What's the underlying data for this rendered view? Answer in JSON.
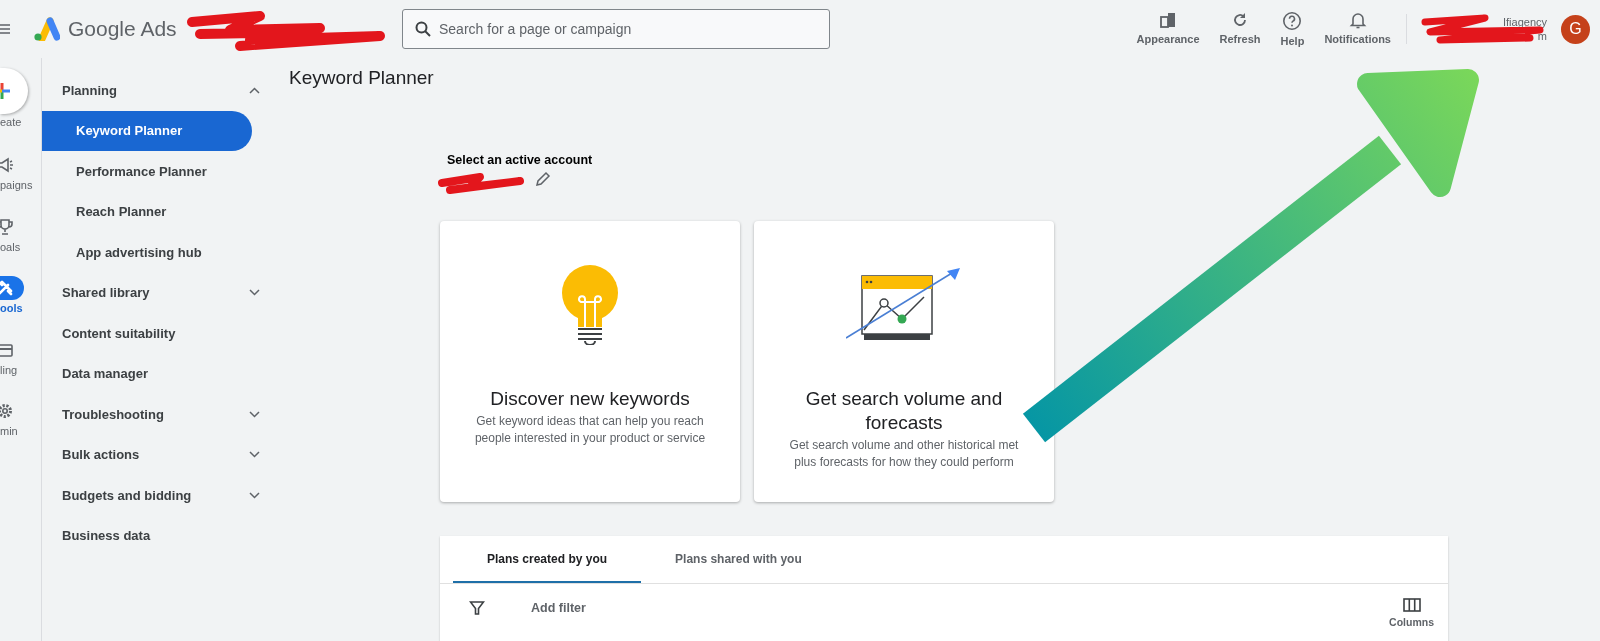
{
  "header": {
    "product": "Google Ads",
    "search": {
      "placeholder": "Search for a page or campaign"
    },
    "actions": [
      {
        "kind": "appearance",
        "label": "Appearance"
      },
      {
        "kind": "refresh",
        "label": "Refresh"
      },
      {
        "kind": "help",
        "label": "Help"
      },
      {
        "kind": "notifications",
        "label": "Notifications"
      }
    ],
    "account": {
      "line_1": "Ifiagency",
      "line_2": "m"
    },
    "avatar": "G"
  },
  "rail": [
    {
      "kind": "create",
      "label": "eate",
      "selected": false
    },
    {
      "kind": "campaigns",
      "label": "paigns",
      "selected": false
    },
    {
      "kind": "goals",
      "label": "oals",
      "selected": false
    },
    {
      "kind": "tools",
      "label": "ools",
      "selected": true
    },
    {
      "kind": "billing",
      "label": "ling",
      "selected": false
    },
    {
      "kind": "admin",
      "label": "min",
      "selected": false
    }
  ],
  "sidebar": {
    "items": [
      {
        "kind": "group",
        "label": "Planning",
        "expanded": true,
        "children": [
          {
            "label": "Keyword Planner",
            "selected": true
          },
          {
            "label": "Performance Planner",
            "selected": false
          },
          {
            "label": "Reach Planner",
            "selected": false
          },
          {
            "label": "App advertising hub",
            "selected": false
          }
        ]
      },
      {
        "kind": "group",
        "label": "Shared library",
        "expanded": false
      },
      {
        "kind": "link",
        "label": "Content suitability"
      },
      {
        "kind": "link",
        "label": "Data manager"
      },
      {
        "kind": "group",
        "label": "Troubleshooting",
        "expanded": false
      },
      {
        "kind": "group",
        "label": "Bulk actions",
        "expanded": false
      },
      {
        "kind": "group",
        "label": "Budgets and bidding",
        "expanded": false
      },
      {
        "kind": "link",
        "label": "Business data"
      }
    ]
  },
  "page_title": "Keyword Planner",
  "account_select": {
    "label": "Select an active account"
  },
  "cards": [
    {
      "kind": "discover",
      "title": "Discover new keywords",
      "lines": [
        "Get keyword ideas that can help you reach",
        "people interested in your product or service"
      ]
    },
    {
      "kind": "forecast",
      "title": "Get search volume and forecasts",
      "lines": [
        "Get search volume and other historical met",
        "plus forecasts for how they could perform"
      ]
    }
  ],
  "plans": {
    "tabs": [
      {
        "label": "Plans created by you",
        "selected": true
      },
      {
        "label": "Plans shared with you",
        "selected": false
      }
    ],
    "filter": {
      "placeholder": "Add filter"
    },
    "columns_button": "Columns"
  }
}
